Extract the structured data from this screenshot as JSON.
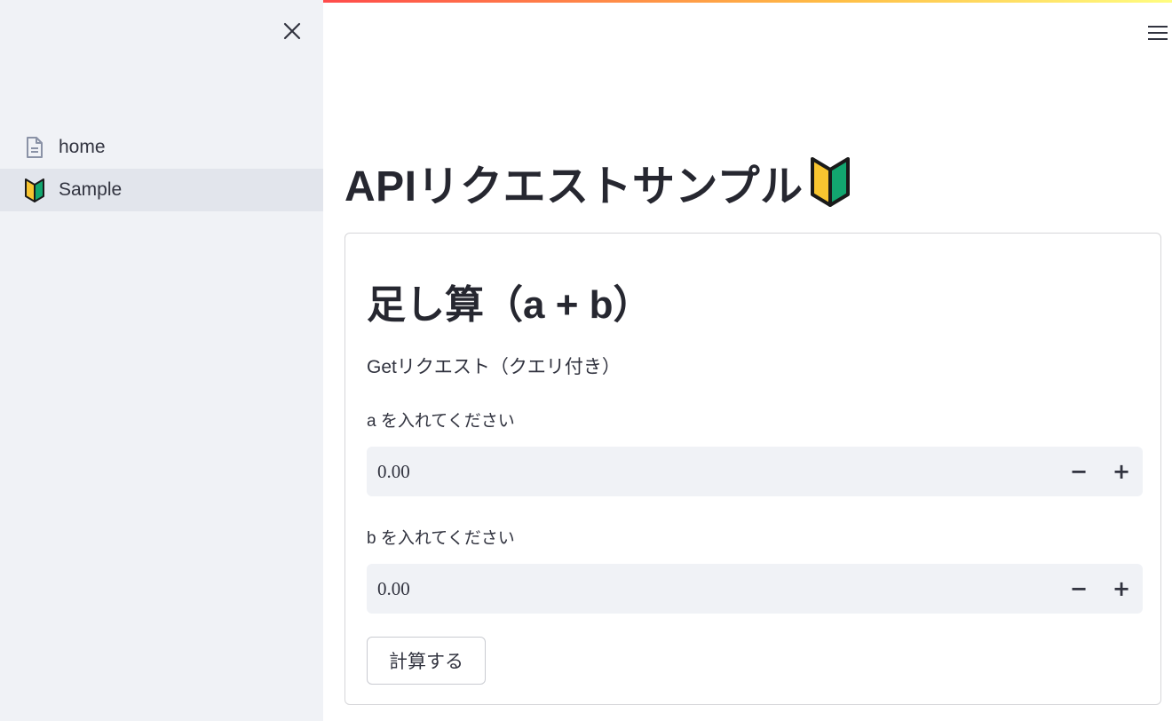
{
  "sidebar": {
    "items": [
      {
        "label": "home",
        "icon": "document-icon",
        "active": false
      },
      {
        "label": "Sample",
        "icon": "beginner-mark-icon",
        "active": true
      }
    ]
  },
  "main": {
    "title": "APIリクエストサンプル",
    "title_icon": "beginner-mark-icon",
    "card": {
      "heading": "足し算（a + b）",
      "description": "Getリクエスト（クエリ付き）",
      "field_a": {
        "label": "a を入れてください",
        "value": "0.00"
      },
      "field_b": {
        "label": "b を入れてください",
        "value": "0.00"
      },
      "stepper": {
        "minus": "−",
        "plus": "+"
      },
      "submit_label": "計算する"
    }
  },
  "colors": {
    "sidebar_bg": "#f0f2f6",
    "active_item_bg": "#e2e5ec",
    "input_bg": "#f0f2f6",
    "beginner_green": "#12a66f",
    "beginner_yellow": "#f8c530"
  }
}
